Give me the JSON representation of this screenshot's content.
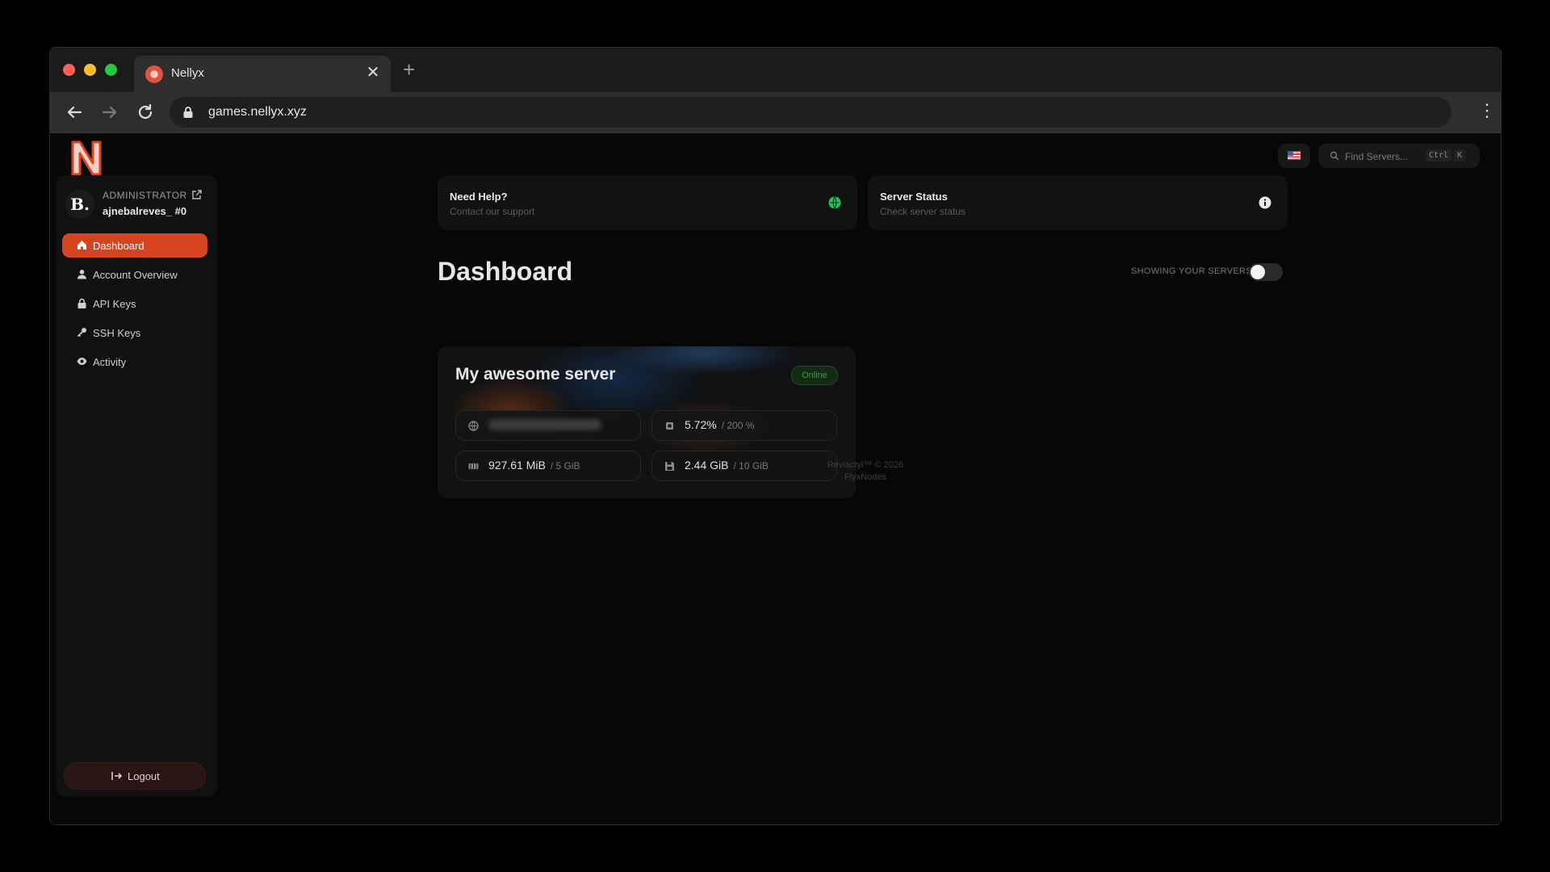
{
  "browser": {
    "tab_title": "Nellyx",
    "tab_close": "✕",
    "new_tab": "+",
    "url": "games.nellyx.xyz"
  },
  "header": {
    "search_placeholder": "Find Servers...",
    "shortcut_ctrl": "Ctrl",
    "shortcut_k": "K"
  },
  "sidebar": {
    "user": {
      "avatar_letter": "B.",
      "role": "ADMINISTRATOR",
      "username": "ajnebalreves_ #0"
    },
    "items": [
      {
        "label": "Dashboard",
        "icon": "home-icon",
        "active": true
      },
      {
        "label": "Account Overview",
        "icon": "user-icon"
      },
      {
        "label": "API Keys",
        "icon": "lock-icon"
      },
      {
        "label": "SSH Keys",
        "icon": "key-icon"
      },
      {
        "label": "Activity",
        "icon": "eye-icon"
      }
    ],
    "logout_label": "Logout"
  },
  "cards": {
    "help": {
      "title": "Need Help?",
      "subtitle": "Contact our support"
    },
    "status": {
      "title": "Server Status",
      "subtitle": "Check server status"
    }
  },
  "main": {
    "title": "Dashboard",
    "toggle_label": "SHOWING YOUR SERVERS",
    "toggle_on": false
  },
  "server": {
    "name": "My awesome server",
    "status": "Online",
    "cpu": {
      "value": "5.72%",
      "max": "/ 200 %"
    },
    "memory": {
      "value": "927.61 MiB",
      "max": "/ 5 GiB"
    },
    "disk": {
      "value": "2.44 GiB",
      "max": "/ 10 GiB"
    }
  },
  "footer": {
    "line1": "Reviactyl™ © 2026",
    "line2": "FlyxNodes"
  },
  "colors": {
    "accent": "#d6431f",
    "online": "#3aa13a",
    "help_icon": "#22c55e"
  }
}
